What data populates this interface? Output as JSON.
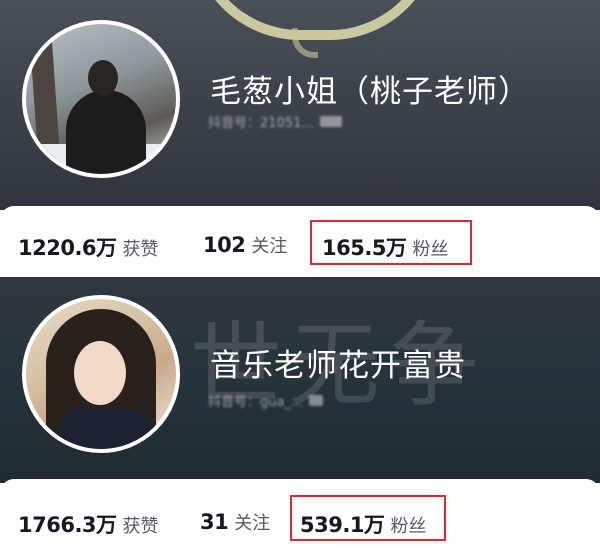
{
  "profiles": [
    {
      "name": "毛葱小姐（桃子老师）",
      "account_id": "抖音号：21051...",
      "stats": {
        "likes_value": "1220.6万",
        "likes_label": "获赞",
        "following_value": "102",
        "following_label": "关注",
        "fans_value": "165.5万",
        "fans_label": "粉丝"
      }
    },
    {
      "name": "音乐老师花开富贵",
      "account_id": "抖音号：gua_...",
      "watermark": "世无争",
      "stats": {
        "likes_value": "1766.3万",
        "likes_label": "获赞",
        "following_value": "31",
        "following_label": "关注",
        "fans_value": "539.1万",
        "fans_label": "粉丝"
      }
    }
  ],
  "colors": {
    "highlight_border": "#e0262e",
    "stat_number": "#161823",
    "stat_label": "#555a64"
  }
}
